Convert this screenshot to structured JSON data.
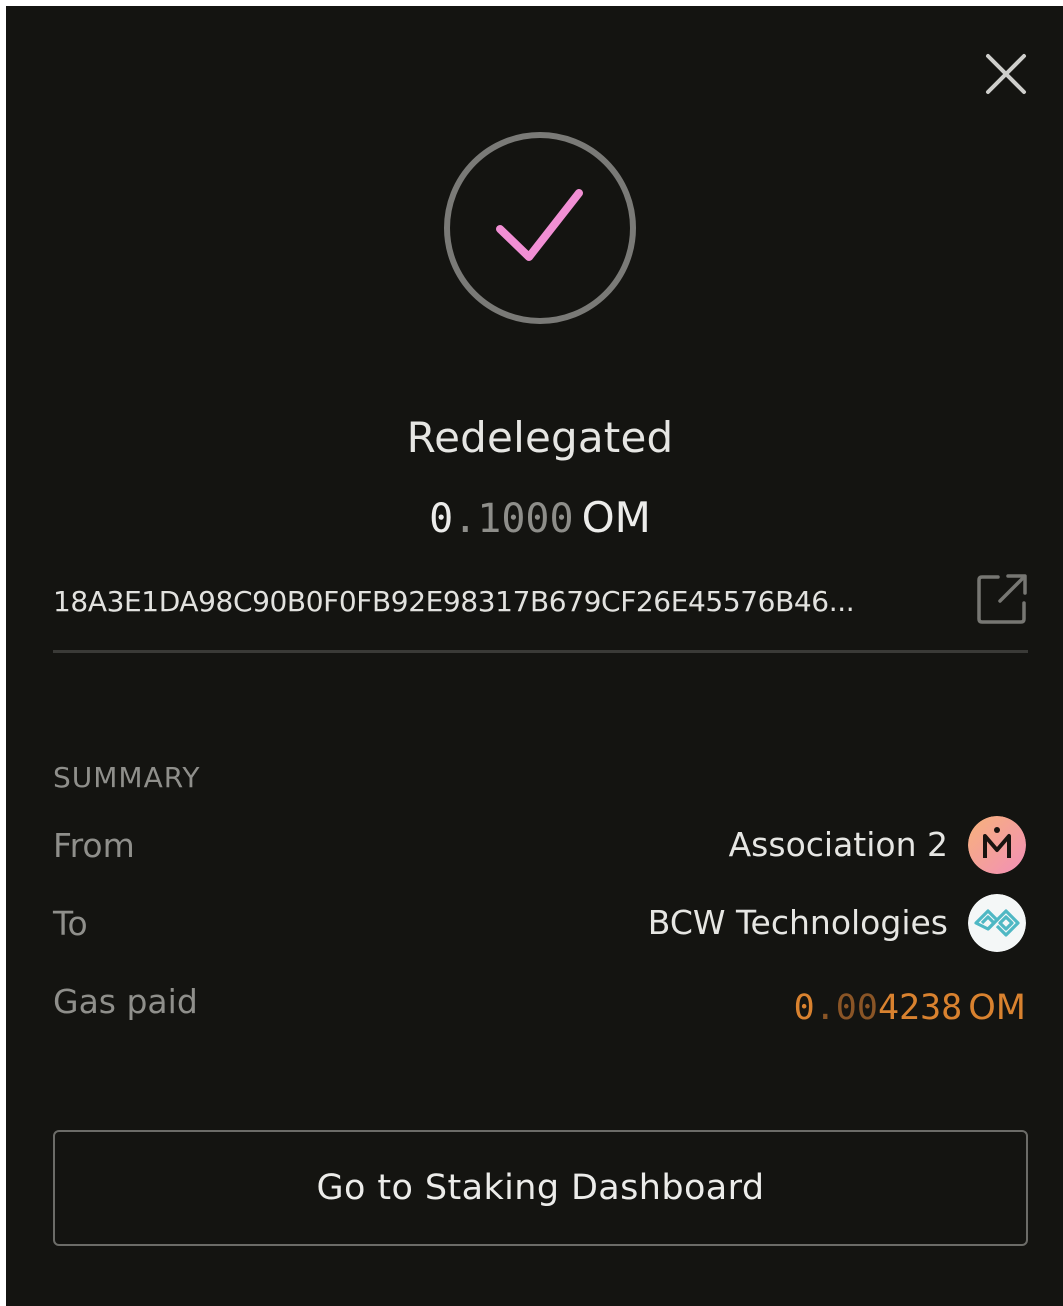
{
  "status": {
    "title": "Redelegated"
  },
  "amount": {
    "lead": "0",
    "rest": ".1000",
    "unit": "OM"
  },
  "tx": {
    "hash": "18A3E1DA98C90B0F0FB92E98317B679CF26E45576B46..."
  },
  "summary": {
    "heading": "SUMMARY",
    "from_label": "From",
    "from_value": "Association 2",
    "to_label": "To",
    "to_value": "BCW Technologies",
    "gas_label": "Gas paid",
    "gas_lead": "0",
    "gas_dim": ".00",
    "gas_rest": "4238",
    "gas_unit": "OM"
  },
  "actions": {
    "dashboard_label": "Go to Staking Dashboard"
  },
  "colors": {
    "background": "#141411",
    "check": "#f18fd4",
    "gas": "#d9822f"
  },
  "icons": [
    "close-icon",
    "check-icon",
    "external-link-icon",
    "association-avatar",
    "bcw-avatar"
  ]
}
